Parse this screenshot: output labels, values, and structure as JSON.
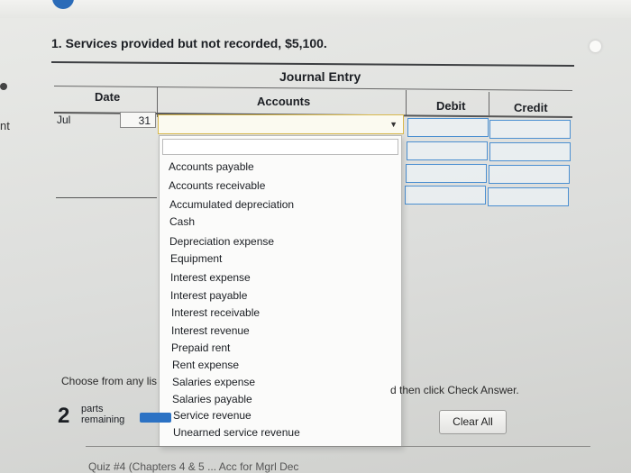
{
  "question": {
    "text": "1. Services provided but not recorded, $5,100."
  },
  "journal": {
    "title": "Journal Entry",
    "columns": {
      "date": "Date",
      "accounts": "Accounts",
      "debit": "Debit",
      "credit": "Credit"
    },
    "entry": {
      "month": "Jul",
      "day": "31"
    }
  },
  "accounts_dropdown": {
    "options": [
      "Accounts payable",
      "Accounts receivable",
      "Accumulated depreciation",
      "Cash",
      "Depreciation expense",
      "Equipment",
      "Interest expense",
      "Interest payable",
      "Interest receivable",
      "Interest revenue",
      "Prepaid rent",
      "Rent expense",
      "Salaries expense",
      "Salaries payable",
      "Service revenue",
      "Unearned service revenue"
    ]
  },
  "instructions": {
    "left": "Choose from any lis",
    "right": "d then click Check Answer."
  },
  "parts": {
    "count": "2",
    "label_line1": "parts",
    "label_line2": "remaining"
  },
  "buttons": {
    "clear_all": "Clear All"
  },
  "left_edge_text": "nt",
  "footer": {
    "text": "Quiz #4 (Chapters 4 & 5 ... Acc for Mgrl Dec"
  },
  "colors": {
    "select_border": "#d8b84c",
    "input_border": "#4b8fd1",
    "progress": "#2c72c4"
  }
}
